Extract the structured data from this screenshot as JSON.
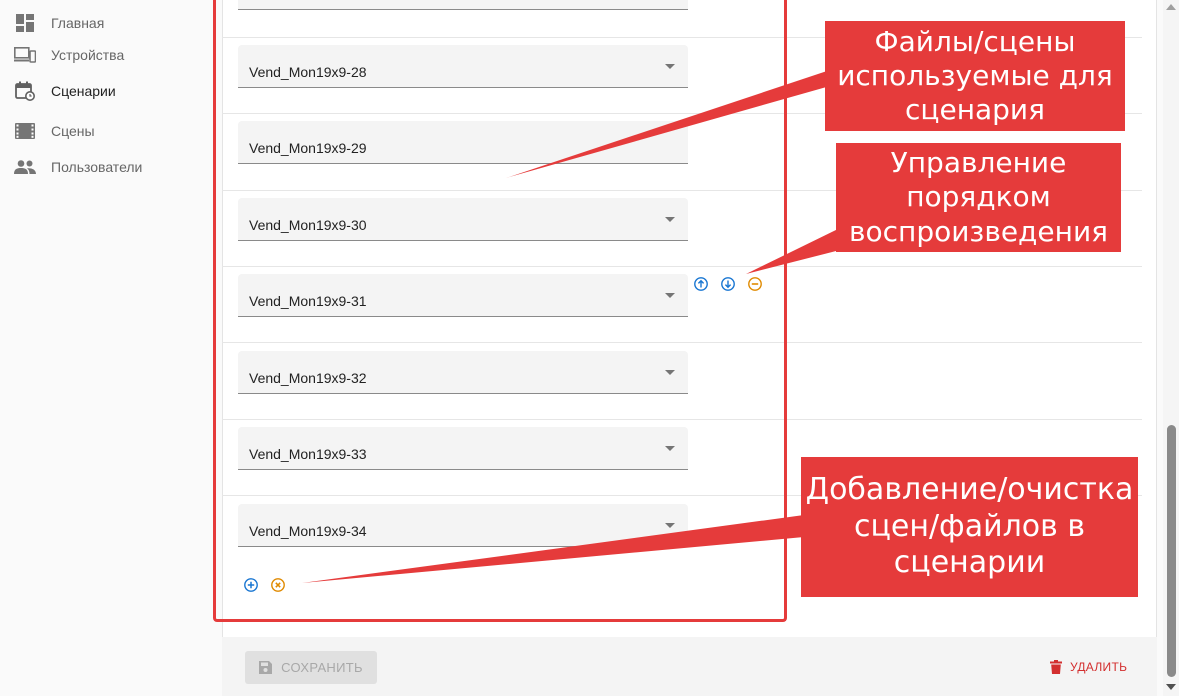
{
  "sidebar": {
    "items": [
      {
        "label": "Главная",
        "icon": "dashboard-icon"
      },
      {
        "label": "Устройства",
        "icon": "devices-icon"
      },
      {
        "label": "Сценарии",
        "icon": "calendar-clock-icon"
      },
      {
        "label": "Сцены",
        "icon": "movie-icon"
      },
      {
        "label": "Пользователи",
        "icon": "people-icon"
      }
    ]
  },
  "scenario": {
    "items": [
      {
        "value": "Vend_Mon19x9-28"
      },
      {
        "value": "Vend_Mon19x9-29"
      },
      {
        "value": "Vend_Mon19x9-30"
      },
      {
        "value": "Vend_Mon19x9-31"
      },
      {
        "value": "Vend_Mon19x9-32"
      },
      {
        "value": "Vend_Mon19x9-33"
      },
      {
        "value": "Vend_Mon19x9-34"
      }
    ]
  },
  "footer": {
    "save_label": "СОХРАНИТЬ",
    "delete_label": "УДАЛИТЬ"
  },
  "annotations": {
    "files": "Файлы/сцены используемые для сценария",
    "order": "Управление порядком воспроизведения",
    "add_clear": "Добавление/очистка сцен/файлов в сценарии"
  },
  "colors": {
    "callout": "#e53b3b",
    "primary_icon": "#1976d2",
    "secondary_icon": "#e08a00",
    "danger": "#d32f2f"
  }
}
